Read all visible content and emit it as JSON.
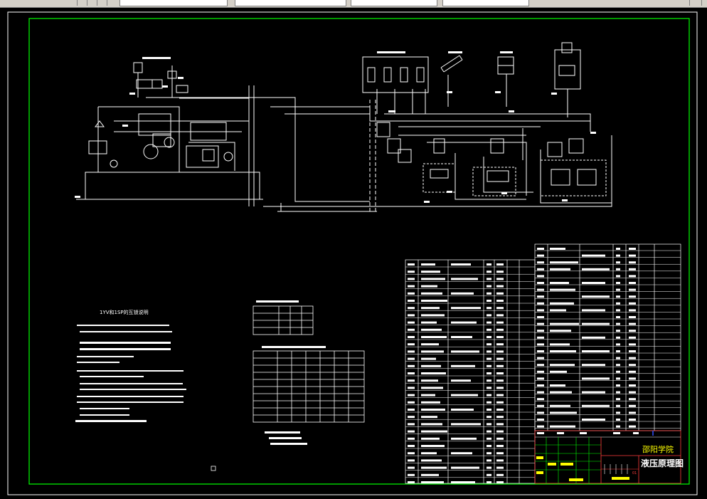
{
  "toolbar": {
    "window_control_icons": [
      "minimize-icon",
      "restore-icon"
    ]
  },
  "drawing": {
    "notes_title": "1YV和1SP的互锁说明",
    "school_name": "邵阳学院",
    "drawing_title": "液压原理图",
    "sheet_label": "01"
  },
  "colors": {
    "background": "#000000",
    "frame": "#00ff00",
    "lines": "#ffffff",
    "accent_yellow": "#ffff00",
    "accent_red": "#ff3b3b",
    "accent_blue": "#3050ff"
  }
}
